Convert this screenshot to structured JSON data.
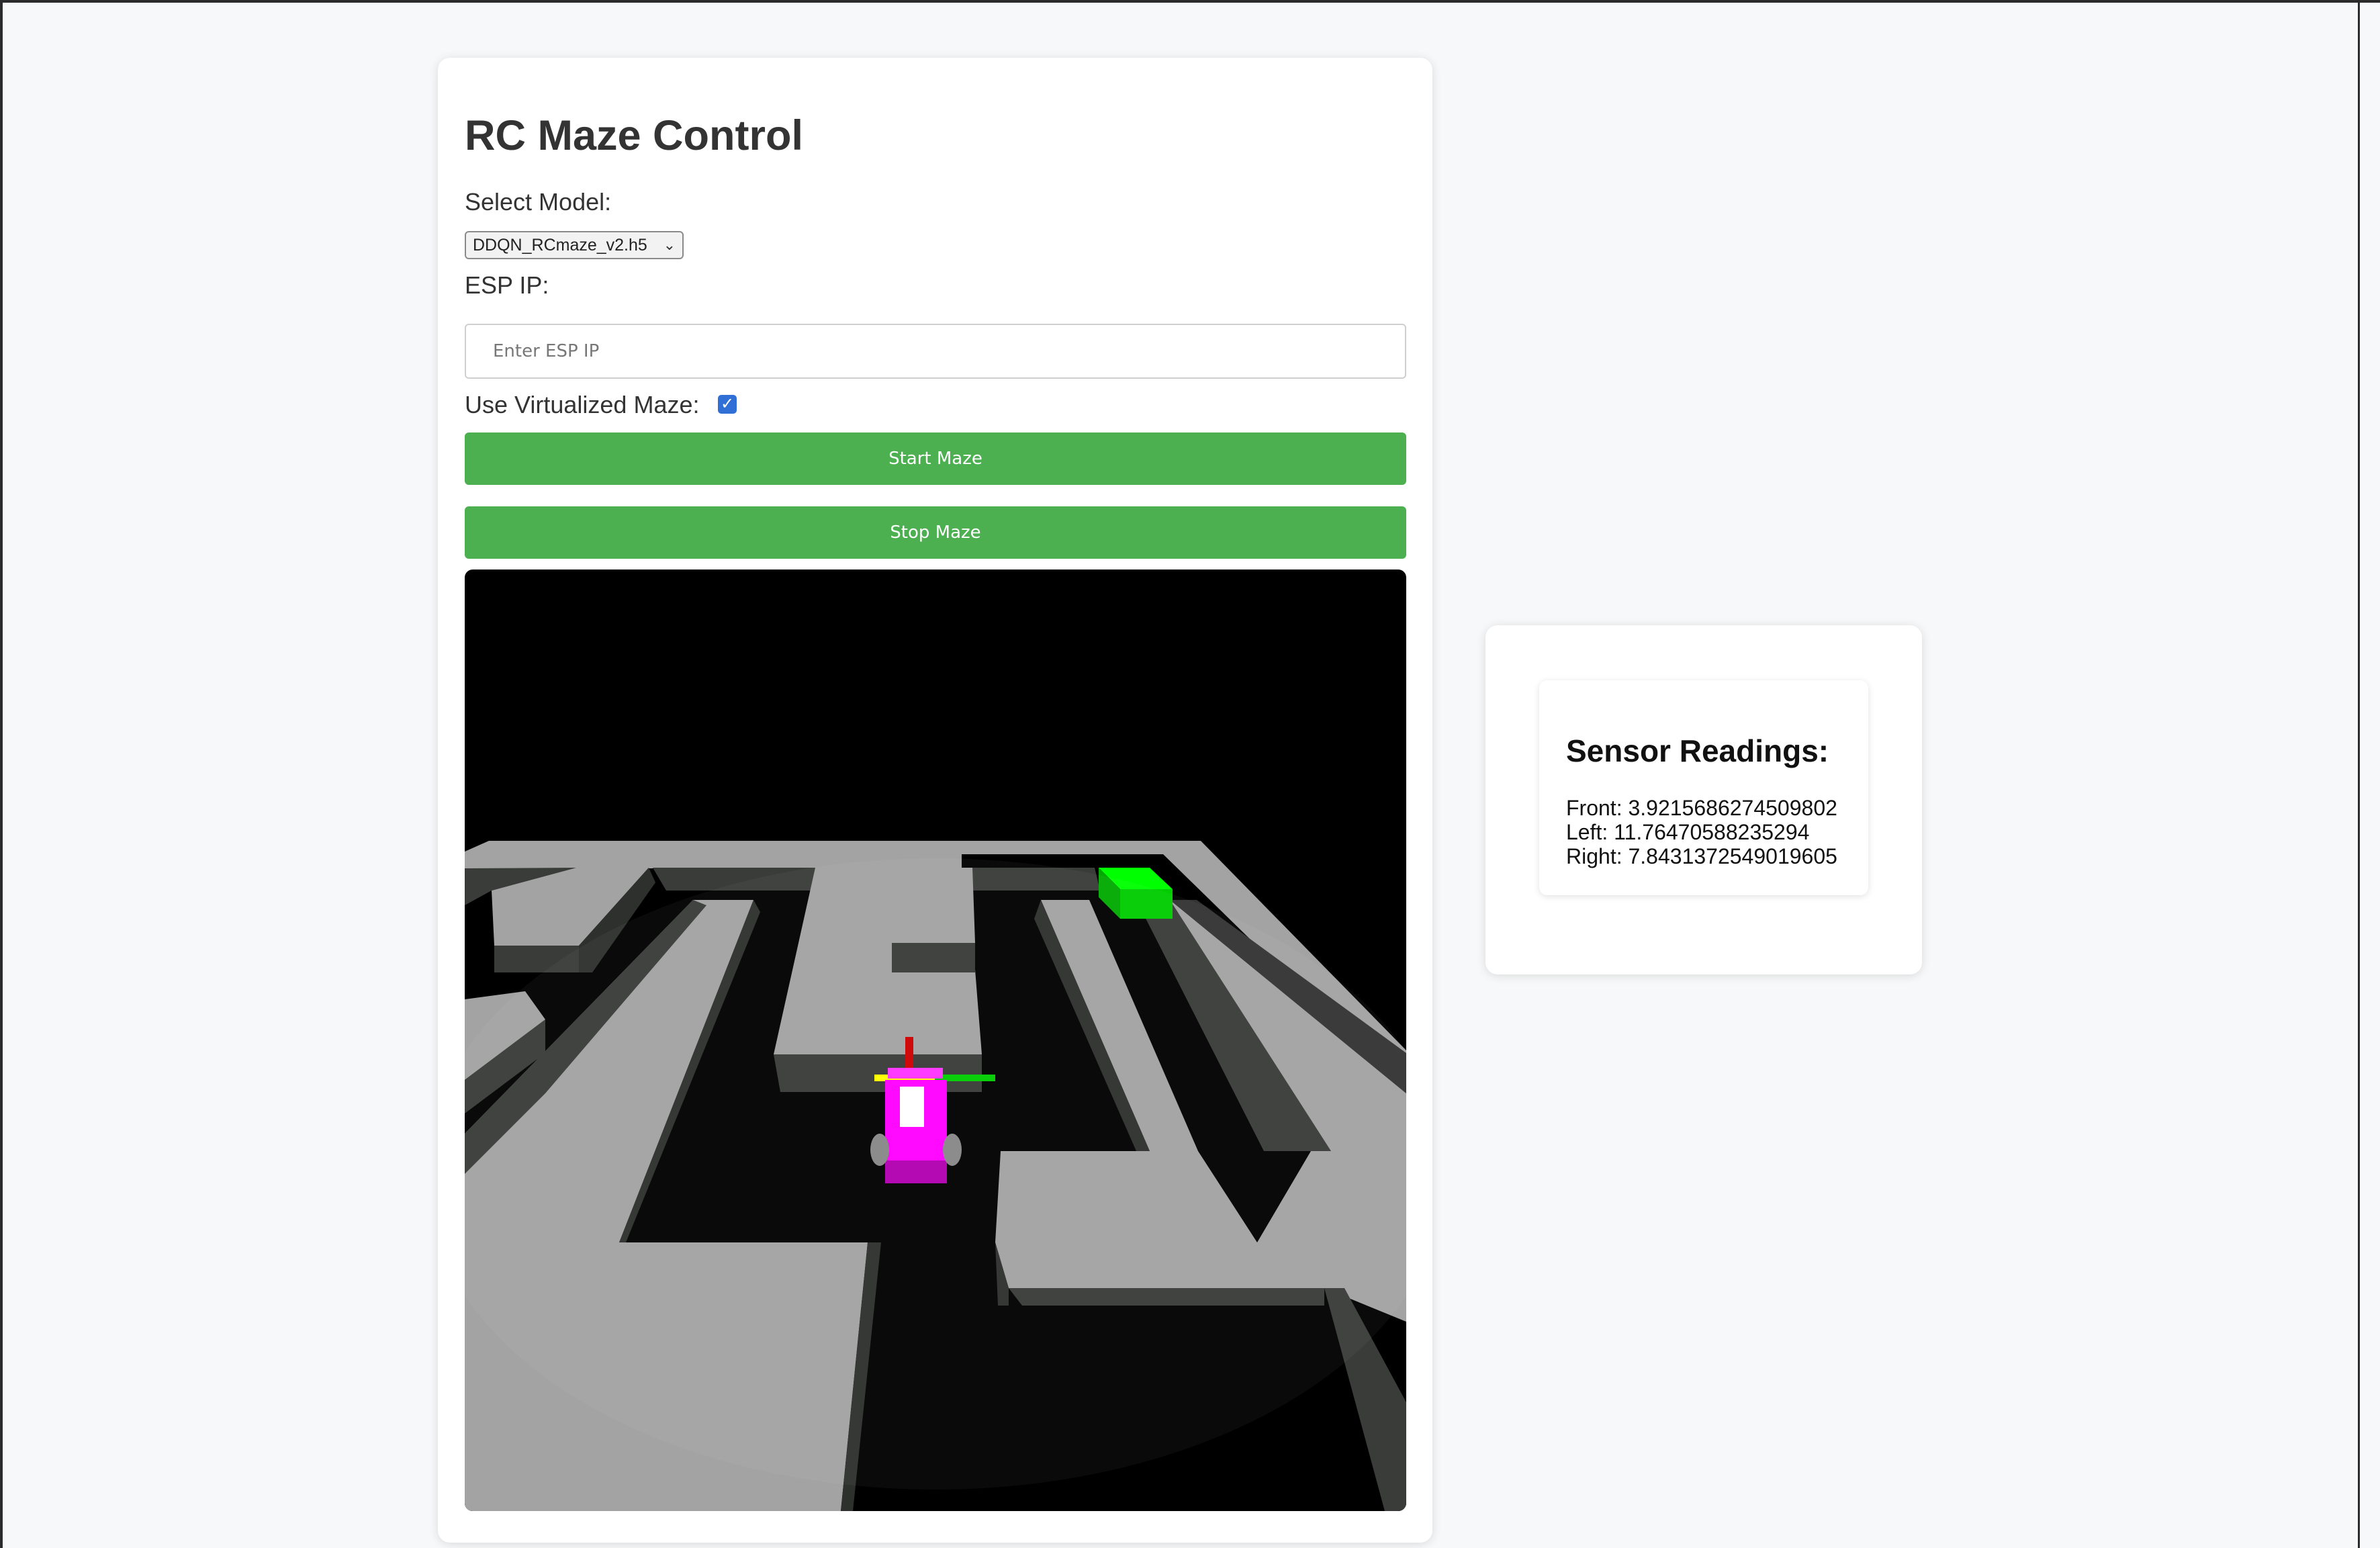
{
  "title": "RC Maze Control",
  "model": {
    "label": "Select Model:",
    "selected": "DDQN_RCmaze_v2.h5"
  },
  "esp": {
    "label": "ESP IP:",
    "placeholder": "Enter ESP IP",
    "value": ""
  },
  "virtualized": {
    "label": "Use Virtualized Maze:",
    "checked": true
  },
  "buttons": {
    "start": "Start Maze",
    "stop": "Stop Maze"
  },
  "sensors": {
    "title": "Sensor Readings:",
    "front": "Front: 3.9215686274509802",
    "left": "Left: 11.76470588235294",
    "right": "Right: 7.8431372549019605"
  },
  "colors": {
    "button": "#4caf50",
    "goal_tile": "#00ff00",
    "car_body": "#ff00ff",
    "wall": "#a3a3a3",
    "wall_shadow": "#3a3c3a"
  }
}
